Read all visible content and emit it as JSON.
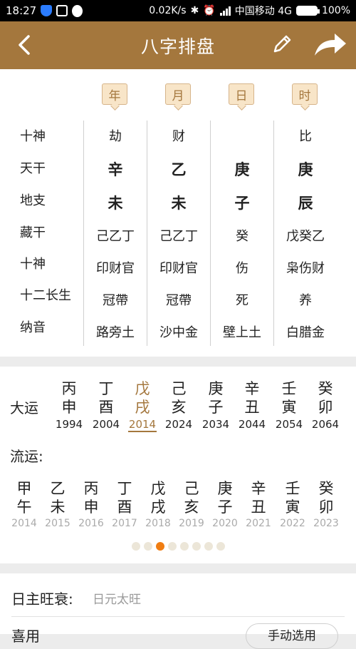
{
  "status_bar": {
    "time": "18:27",
    "network_speed": "0.02K/s",
    "carrier": "中国移动 4G",
    "battery": "100%"
  },
  "header": {
    "title": "八字排盘",
    "icons": [
      "back-arrow-icon",
      "pencil-edit-icon",
      "share-arrow-icon"
    ]
  },
  "pillars": {
    "headers": [
      "年",
      "月",
      "日",
      "时"
    ],
    "row_labels": [
      "十神",
      "天干",
      "地支",
      "藏干",
      "十神",
      "十二长生",
      "纳音"
    ],
    "columns": [
      [
        "劫",
        "辛",
        "未",
        "己乙丁",
        "印财官",
        "冠帶",
        "路旁土"
      ],
      [
        "财",
        "乙",
        "未",
        "己乙丁",
        "印财官",
        "冠帶",
        "沙中金"
      ],
      [
        "",
        "庚",
        "子",
        "癸",
        "伤",
        "死",
        "壁上土"
      ],
      [
        "比",
        "庚",
        "辰",
        "戊癸乙",
        "枭伤财",
        "养",
        "白腊金"
      ]
    ]
  },
  "dayun": {
    "label": "大运",
    "items": [
      {
        "gan": "丙",
        "zhi": "申",
        "year": "1994"
      },
      {
        "gan": "丁",
        "zhi": "酉",
        "year": "2004"
      },
      {
        "gan": "戊",
        "zhi": "戌",
        "year": "2014"
      },
      {
        "gan": "己",
        "zhi": "亥",
        "year": "2024"
      },
      {
        "gan": "庚",
        "zhi": "子",
        "year": "2034"
      },
      {
        "gan": "辛",
        "zhi": "丑",
        "year": "2044"
      },
      {
        "gan": "壬",
        "zhi": "寅",
        "year": "2054"
      },
      {
        "gan": "癸",
        "zhi": "卯",
        "year": "2064"
      }
    ],
    "active_index": 2
  },
  "liuyun": {
    "label": "流运:",
    "items": [
      {
        "gan": "甲",
        "zhi": "午",
        "year": "2014"
      },
      {
        "gan": "乙",
        "zhi": "未",
        "year": "2015"
      },
      {
        "gan": "丙",
        "zhi": "申",
        "year": "2016"
      },
      {
        "gan": "丁",
        "zhi": "酉",
        "year": "2017"
      },
      {
        "gan": "戊",
        "zhi": "戌",
        "year": "2018"
      },
      {
        "gan": "己",
        "zhi": "亥",
        "year": "2019"
      },
      {
        "gan": "庚",
        "zhi": "子",
        "year": "2020"
      },
      {
        "gan": "辛",
        "zhi": "丑",
        "year": "2021"
      },
      {
        "gan": "壬",
        "zhi": "寅",
        "year": "2022"
      },
      {
        "gan": "癸",
        "zhi": "卯",
        "year": "2023"
      }
    ],
    "page_count": 8,
    "active_page": 2
  },
  "summary": {
    "strength_label": "日主旺衰:",
    "strength_value": "日元太旺",
    "next_label": "喜用",
    "select_button": "手动选用"
  },
  "colors": {
    "brand": "#a4773d",
    "active_dot": "#f07d12",
    "header_tag_bg": "#f8e5c8"
  }
}
